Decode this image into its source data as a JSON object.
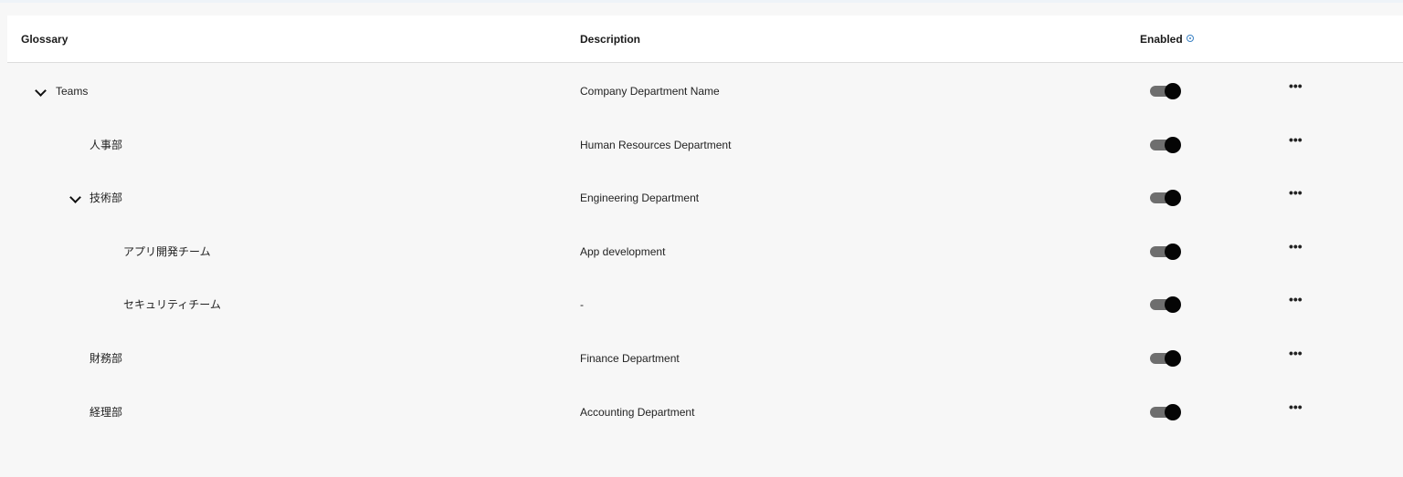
{
  "table": {
    "headers": {
      "glossary": "Glossary",
      "description": "Description",
      "enabled": "Enabled"
    },
    "rows": [
      {
        "name": "Teams",
        "description": "Company Department Name",
        "level": 0,
        "expandable": true,
        "enabled": true
      },
      {
        "name": "人事部",
        "description": "Human Resources Department",
        "level": 1,
        "expandable": false,
        "enabled": true
      },
      {
        "name": "技術部",
        "description": "Engineering Department",
        "level": 1,
        "expandable": true,
        "enabled": true
      },
      {
        "name": "アプリ開発チーム",
        "description": "App development",
        "level": 2,
        "expandable": false,
        "enabled": true
      },
      {
        "name": "セキュリティチーム",
        "description": "-",
        "level": 2,
        "expandable": false,
        "enabled": true
      },
      {
        "name": "財務部",
        "description": "Finance Department",
        "level": 1,
        "expandable": false,
        "enabled": true
      },
      {
        "name": "経理部",
        "description": "Accounting Department",
        "level": 1,
        "expandable": false,
        "enabled": true
      }
    ]
  },
  "icons": {
    "expand": "chevron-down-icon",
    "more": "more-horizontal-icon",
    "info": "info-icon"
  },
  "colors": {
    "toggle_track": "#6e6e6e",
    "toggle_knob": "#050505",
    "info_accent": "#3b82c4"
  },
  "more_label": "•••"
}
